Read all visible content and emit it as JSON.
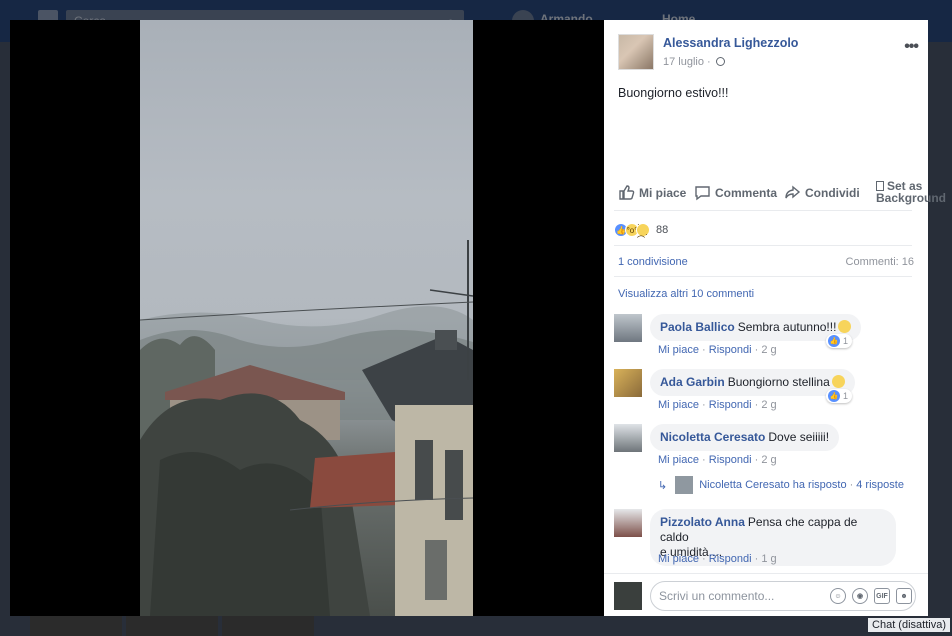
{
  "background": {
    "search_placeholder": "Cerca",
    "user_name": "Armando",
    "home_label": "Home",
    "chat_label": "Chat (disattiva)"
  },
  "post": {
    "author": "Alessandra Lighezzolo",
    "date": "17 luglio",
    "privacy_icon": "globe-icon",
    "text": "Buongiorno estivo!!!",
    "actions": {
      "like": "Mi piace",
      "comment": "Commenta",
      "share": "Condividi",
      "background_line1": "Set as",
      "background_line2": "Background"
    },
    "reactions": {
      "types": [
        "like",
        "wow",
        "sad"
      ],
      "count": "88"
    },
    "shares": "1 condivisione",
    "comments_count": "Commenti: 16",
    "view_more": "Visualizza altri 10 commenti"
  },
  "comments": [
    {
      "name": "Paola Ballico",
      "text": "Sembra autunno!!!",
      "emoji": "laughing",
      "likes": "1",
      "like": "Mi piace",
      "reply": "Rispondi",
      "time": "2 g"
    },
    {
      "name": "Ada Garbin",
      "text": "Buongiorno stellina",
      "emoji": "kiss",
      "likes": "1",
      "like": "Mi piace",
      "reply": "Rispondi",
      "time": "2 g"
    },
    {
      "name": "Nicoletta Ceresato",
      "text": "Dove seiiiii!",
      "like": "Mi piace",
      "reply": "Rispondi",
      "time": "2 g",
      "reply_summary": {
        "text": "Nicoletta Ceresato ha risposto",
        "count": "4 risposte"
      }
    },
    {
      "name": "Pizzolato Anna",
      "text_line1": "Pensa che cappa de caldo",
      "text_line2": "e umidità....",
      "like": "Mi piace",
      "reply": "Rispondi",
      "time": "1 g"
    }
  ],
  "composer": {
    "placeholder": "Scrivi un commento...",
    "icons": [
      "emoji-icon",
      "camera-icon",
      "gif-icon",
      "sticker-icon"
    ],
    "gif_label": "GIF"
  },
  "colors": {
    "link_blue": "#365899",
    "action_blue": "#4267b2",
    "meta_gray": "#90949c",
    "fb_blue": "#29487d"
  }
}
